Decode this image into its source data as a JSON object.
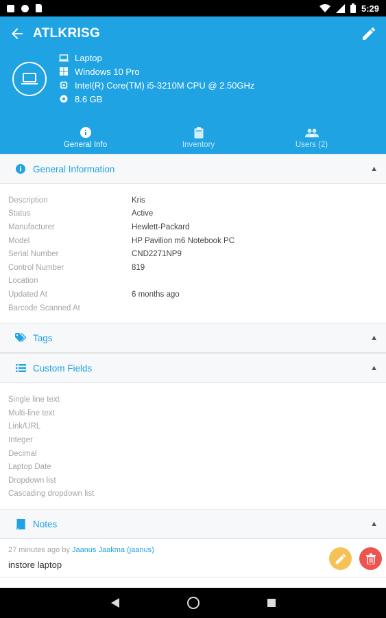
{
  "status_bar": {
    "time": "5:29",
    "icons": [
      "square-icon",
      "circle-icon",
      "sd-card-icon"
    ],
    "right_icons": [
      "wifi-icon",
      "signal-icon",
      "battery-icon"
    ]
  },
  "header": {
    "title": "ATLKRISG",
    "back_icon": "arrow-left-icon",
    "edit_icon": "pencil-icon",
    "background": "#1fa3e3",
    "device": {
      "type": "Laptop",
      "os": "Windows 10 Pro",
      "cpu": "Intel(R) Core(TM) i5-3210M CPU @ 2.50GHz",
      "ram": "8.6 GB"
    },
    "tabs": [
      {
        "label": "General Info",
        "icon": "info-icon",
        "active": true
      },
      {
        "label": "Inventory",
        "icon": "clipboard-icon",
        "active": false
      },
      {
        "label": "Users (2)",
        "icon": "users-icon",
        "active": false
      }
    ]
  },
  "general": {
    "title": "General Information",
    "rows": [
      {
        "key": "Description",
        "value": "Kris"
      },
      {
        "key": "Status",
        "value": "Active"
      },
      {
        "key": "Manufacturer",
        "value": "Hewlett-Packard"
      },
      {
        "key": "Model",
        "value": "HP Pavilion m6 Notebook PC"
      },
      {
        "key": "Serial Number",
        "value": "CND2271NP9"
      },
      {
        "key": "Control Number",
        "value": "819"
      },
      {
        "key": "Location",
        "value": ""
      },
      {
        "key": "Updated At",
        "value": "6 months ago"
      },
      {
        "key": "Barcode Scanned At",
        "value": ""
      }
    ]
  },
  "tags": {
    "title": "Tags"
  },
  "custom_fields": {
    "title": "Custom Fields",
    "rows": [
      "Single line text",
      "Multi-line text",
      "Link/URL",
      "Integer",
      "Decimal",
      "Laptop Date",
      "Dropdown list",
      "Cascading dropdown list"
    ]
  },
  "notes": {
    "title": "Notes",
    "items": [
      {
        "time": "27 minutes ago by ",
        "author": "Jaanus Jaakma (jaanus)",
        "text": "instore laptop"
      }
    ]
  },
  "colors": {
    "accent": "#1fa3e3",
    "edit": "#f6c255",
    "delete": "#ef5350"
  }
}
